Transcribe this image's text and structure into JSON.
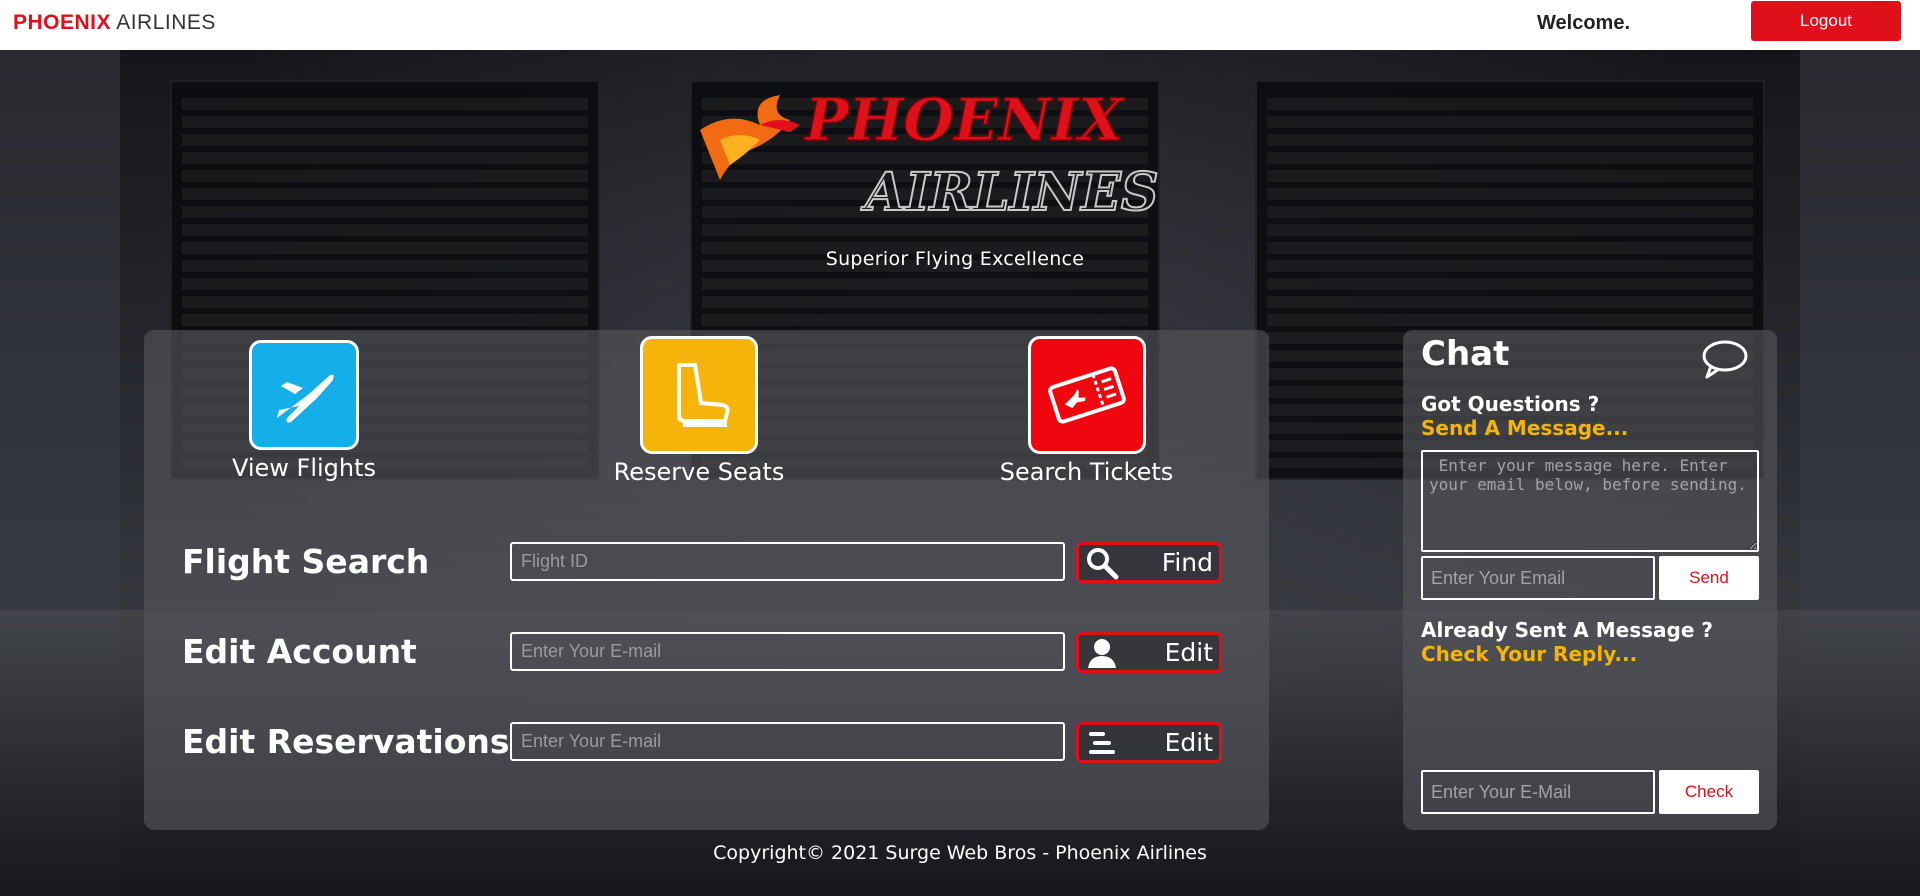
{
  "topbar": {
    "brand_bold": "PHOENIX",
    "brand_rest": "AIRLINES",
    "welcome": "Welcome.",
    "logout_label": "Logout"
  },
  "hero": {
    "tagline": "Superior Flying Excellence",
    "logo_text_1": "PHOENIX",
    "logo_text_2": "AIRLINES"
  },
  "tiles": [
    {
      "label": "View Flights",
      "icon": "airplane-icon",
      "color": "#14aee8"
    },
    {
      "label": "Reserve Seats",
      "icon": "seat-icon",
      "color": "#f6b30a"
    },
    {
      "label": "Search Tickets",
      "icon": "ticket-icon",
      "color": "#f0060e"
    }
  ],
  "forms": {
    "flight_search": {
      "label": "Flight Search",
      "placeholder": "Flight ID",
      "button": "Find",
      "icon": "search-icon"
    },
    "edit_account": {
      "label": "Edit Account",
      "placeholder": "Enter Your E-mail",
      "button": "Edit",
      "icon": "user-icon"
    },
    "edit_reservations": {
      "label": "Edit Reservations",
      "placeholder": "Enter Your E-mail",
      "button": "Edit",
      "icon": "list-icon"
    }
  },
  "chat": {
    "title": "Chat",
    "icon": "speech-bubble-icon",
    "question": "Got Questions ?",
    "send_link": "Send A Message...",
    "message_placeholder": " Enter your message here. Enter your email below, before sending.",
    "email_placeholder": "Enter Your Email",
    "send_label": "Send",
    "already_sent": "Already Sent A Message ?",
    "reply_link": "Check Your Reply...",
    "check_email_placeholder": "Enter Your E-Mail",
    "check_label": "Check"
  },
  "footer": {
    "copyright": "Copyright© 2021 Surge Web Bros - Phoenix Airlines"
  },
  "colors": {
    "accent": "#e0101a",
    "highlight": "#f6b30a"
  }
}
